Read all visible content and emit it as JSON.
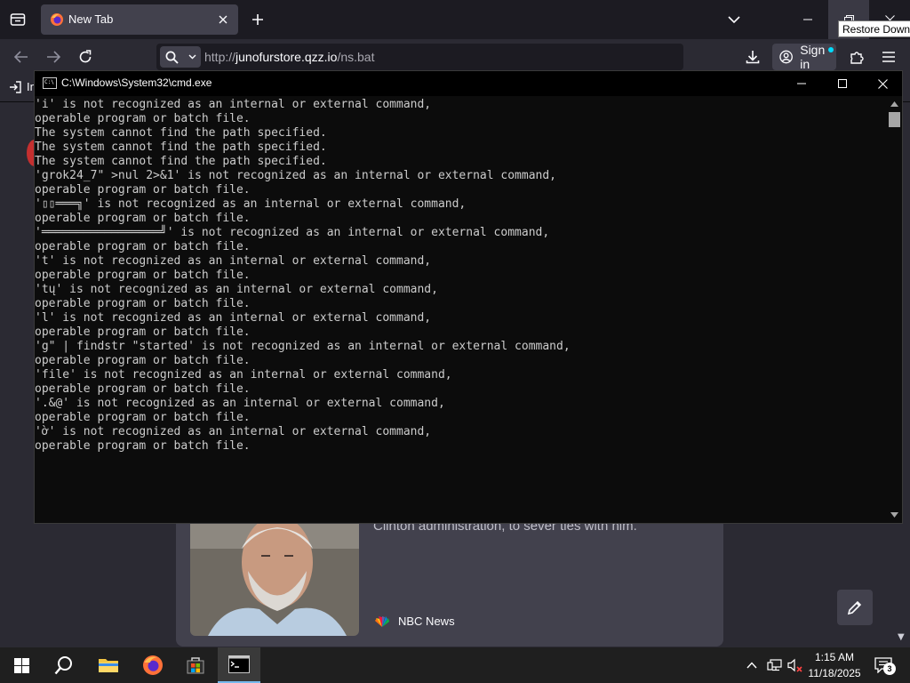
{
  "browser": {
    "tab": {
      "title": "New Tab"
    },
    "url": {
      "prefix": "http://",
      "host": "junofurstore.qzz.io",
      "path": "/ns.bat"
    },
    "signin_label": "Sign in",
    "tooltip": "Restore Down",
    "bookmarks": {
      "import_label": "In"
    }
  },
  "newtab": {
    "news_snippet": "Clinton administration, to sever ties with him.",
    "news_source": "NBC News"
  },
  "cmd": {
    "title": "C:\\Windows\\System32\\cmd.exe",
    "lines": [
      "'i' is not recognized as an internal or external command,",
      "operable program or batch file.",
      "The system cannot find the path specified.",
      "The system cannot find the path specified.",
      "The system cannot find the path specified.",
      "'grok24_7\" >nul 2>&1' is not recognized as an internal or external command,",
      "operable program or batch file.",
      "'▯▯═══╗' is not recognized as an internal or external command,",
      "operable program or batch file.",
      "'═════════════════╝' is not recognized as an internal or external command,",
      "operable program or batch file.",
      "'t' is not recognized as an internal or external command,",
      "operable program or batch file.",
      "'tų' is not recognized as an internal or external command,",
      "operable program or batch file.",
      "'l' is not recognized as an internal or external command,",
      "operable program or batch file.",
      "'g\" | findstr \"started' is not recognized as an internal or external command,",
      "operable program or batch file.",
      "'file' is not recognized as an internal or external command,",
      "operable program or batch file.",
      "'.&@' is not recognized as an internal or external command,",
      "operable program or batch file.",
      "'ờ' is not recognized as an internal or external command,",
      "operable program or batch file."
    ]
  },
  "taskbar": {
    "time": "1:15 AM",
    "date": "11/18/2025",
    "notification_count": "3"
  },
  "icons": {
    "tab_list": "tab-list-icon",
    "firefox": "firefox-icon",
    "close": "close-icon",
    "new_tab": "plus-icon",
    "overflow": "chevron-down-icon",
    "back": "back-arrow-icon",
    "forward": "forward-arrow-icon",
    "reload": "reload-icon",
    "search": "search-icon",
    "download": "download-icon",
    "account": "account-icon",
    "extensions": "puzzle-icon",
    "menu": "hamburger-icon",
    "windows": "windows-start-icon",
    "file_explorer": "folder-icon",
    "store": "store-icon",
    "cmd": "cmd-icon",
    "edit": "pencil-icon"
  },
  "colors": {
    "cmd_background": "#0c0c0c",
    "cmd_text": "#cccccc",
    "browser_chrome": "#2b2a33",
    "taskbar": "#1f1f1f"
  }
}
